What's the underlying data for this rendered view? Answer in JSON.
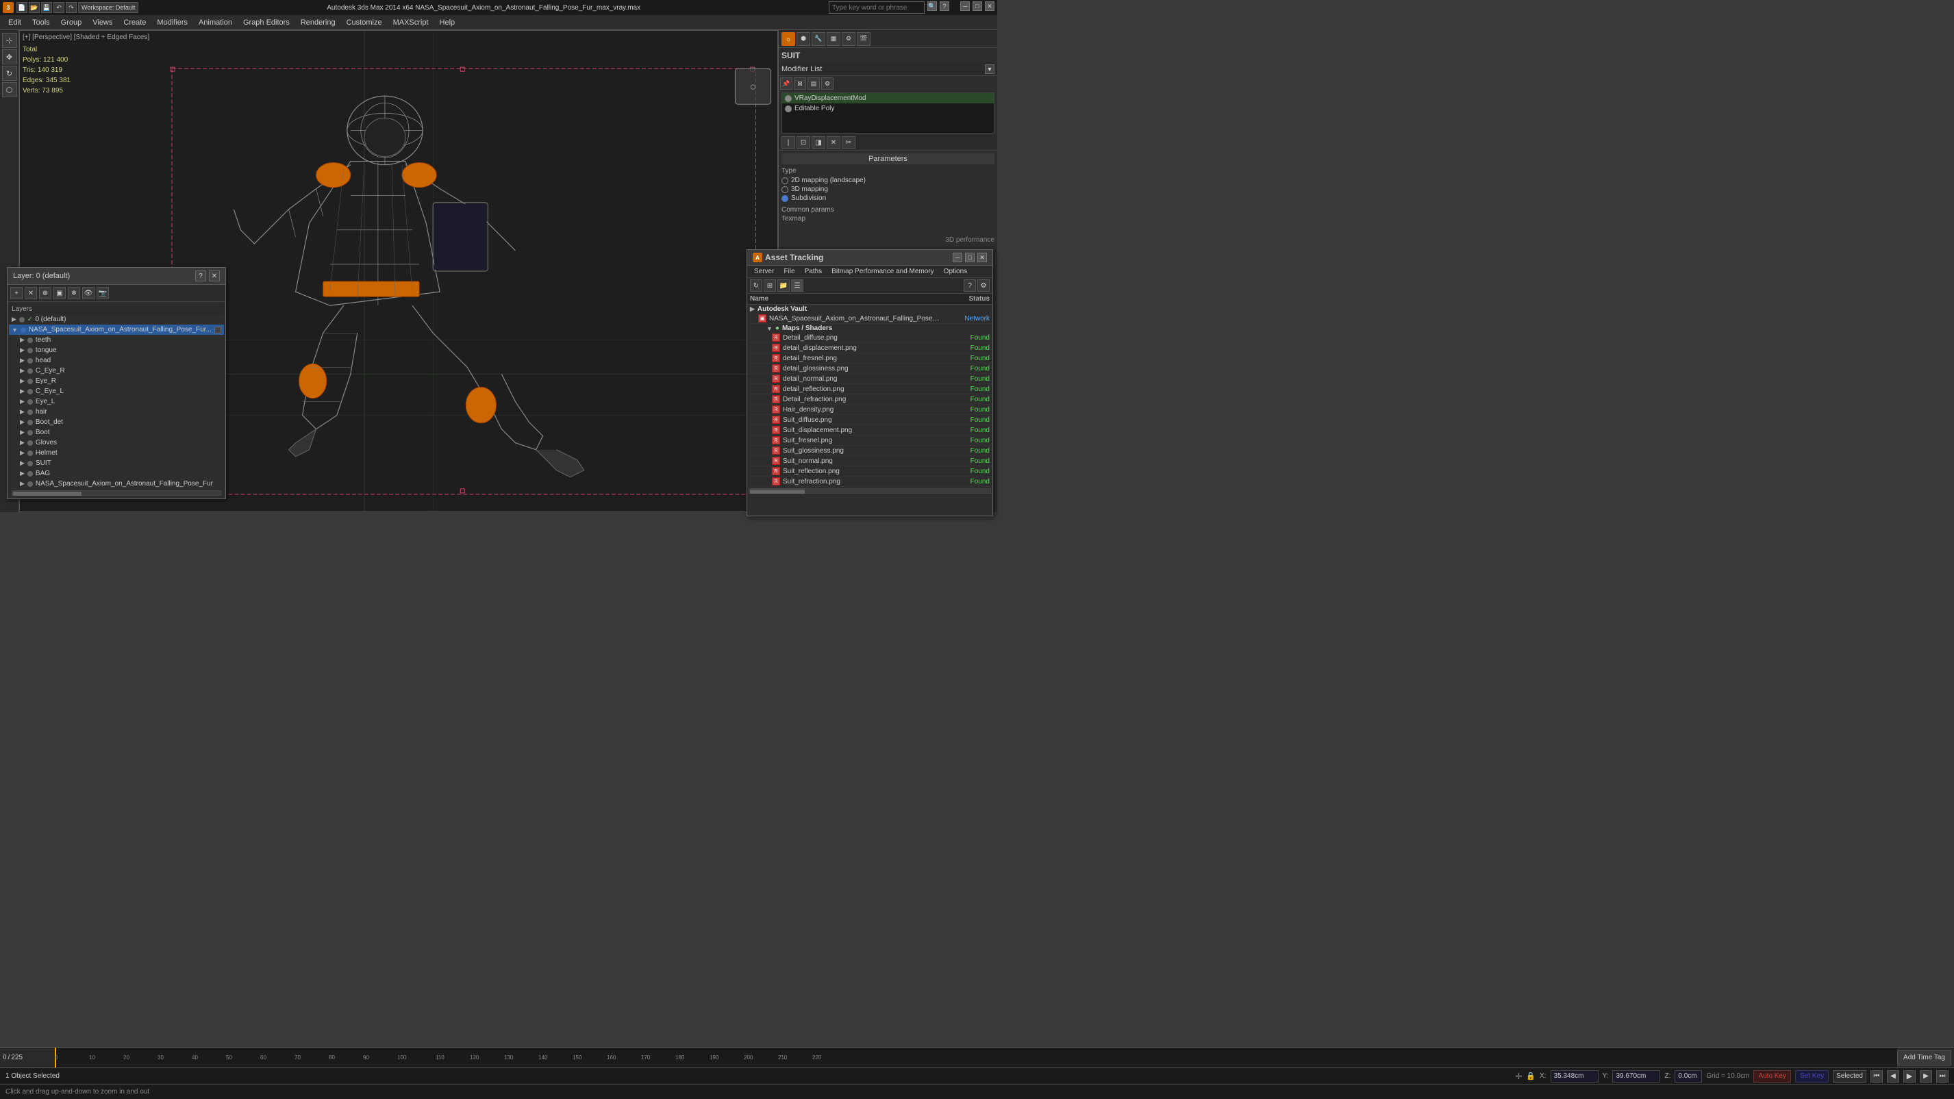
{
  "titlebar": {
    "title": "Autodesk 3ds Max  2014 x64     NASA_Spacesuit_Axiom_on_Astronaut_Falling_Pose_Fur_max_vray.max",
    "app_icon": "3dsmax-icon",
    "min_label": "─",
    "max_label": "□",
    "close_label": "✕"
  },
  "toolbar": {
    "search_placeholder": "Type key word or phrase",
    "workspace_label": "Workspace: Default"
  },
  "menubar": {
    "items": [
      "Edit",
      "Tools",
      "Group",
      "Views",
      "Create",
      "Modifiers",
      "Animation",
      "Graph Editors",
      "Rendering",
      "Customize",
      "MAXScript",
      "Help"
    ]
  },
  "viewport": {
    "label": "[+] [Perspective] [Shaded + Edged Faces]",
    "stats": {
      "total_label": "Total",
      "polys_label": "Polys:",
      "polys_value": "121 400",
      "tris_label": "Tris:",
      "tris_value": "140 319",
      "edges_label": "Edges:",
      "edges_value": "345 381",
      "verts_label": "Verts:",
      "verts_value": "73 895"
    }
  },
  "right_panel": {
    "suit_label": "SUIT",
    "modifier_list_label": "Modifier List",
    "modifiers": [
      {
        "name": "VRayDisplacementMod"
      },
      {
        "name": "Editable Poly"
      }
    ],
    "params_title": "Parameters",
    "type_label": "Type",
    "type_options": [
      {
        "label": "2D mapping (landscape)",
        "selected": false
      },
      {
        "label": "3D mapping",
        "selected": false
      },
      {
        "label": "Subdivision",
        "selected": true
      }
    ],
    "common_params_label": "Common params",
    "texmap_label": "Texmap"
  },
  "layer_panel": {
    "title": "Layer: 0 (default)",
    "close_label": "✕",
    "help_label": "?",
    "layers_header": "Layers",
    "items": [
      {
        "label": "0 (default)",
        "indent": 0,
        "selected": false,
        "check": "✓"
      },
      {
        "label": "NASA_Spacesuit_Axiom_on_Astronaut_Falling_Pose_Fur...",
        "indent": 0,
        "selected": true
      },
      {
        "label": "teeth",
        "indent": 1,
        "selected": false
      },
      {
        "label": "tongue",
        "indent": 1,
        "selected": false
      },
      {
        "label": "head",
        "indent": 1,
        "selected": false
      },
      {
        "label": "C_Eye_R",
        "indent": 1,
        "selected": false
      },
      {
        "label": "Eye_R",
        "indent": 1,
        "selected": false
      },
      {
        "label": "C_Eye_L",
        "indent": 1,
        "selected": false
      },
      {
        "label": "Eye_L",
        "indent": 1,
        "selected": false
      },
      {
        "label": "hair",
        "indent": 1,
        "selected": false
      },
      {
        "label": "Boot_det",
        "indent": 1,
        "selected": false
      },
      {
        "label": "Boot",
        "indent": 1,
        "selected": false
      },
      {
        "label": "Gloves",
        "indent": 1,
        "selected": false
      },
      {
        "label": "Helmet",
        "indent": 1,
        "selected": false
      },
      {
        "label": "SUIT",
        "indent": 1,
        "selected": false
      },
      {
        "label": "BAG",
        "indent": 1,
        "selected": false
      },
      {
        "label": "NASA_Spacesuit_Axiom_on_Astronaut_Falling_Pose_Fur",
        "indent": 1,
        "selected": false
      }
    ]
  },
  "asset_tracking": {
    "title": "Asset Tracking",
    "server_menu": "Server",
    "file_menu": "File",
    "paths_menu": "Paths",
    "bitmap_menu": "Bitmap Performance and Memory",
    "options_menu": "Options",
    "columns": {
      "name": "Name",
      "status": "Status"
    },
    "items": [
      {
        "type": "group",
        "name": "Autodesk Vault",
        "indent": 0,
        "status": ""
      },
      {
        "type": "file",
        "name": "NASA_Spacesuit_Axiom_on_Astronaut_Falling_Pose_Fur_max_v...",
        "indent": 1,
        "status": "Network",
        "status_class": "status-network"
      },
      {
        "type": "group",
        "name": "Maps / Shaders",
        "indent": 2,
        "status": ""
      },
      {
        "type": "file",
        "name": "Detail_diffuse.png",
        "indent": 3,
        "status": "Found",
        "status_class": "status-found"
      },
      {
        "type": "file",
        "name": "detail_displacement.png",
        "indent": 3,
        "status": "Found",
        "status_class": "status-found"
      },
      {
        "type": "file",
        "name": "detail_fresnel.png",
        "indent": 3,
        "status": "Found",
        "status_class": "status-found"
      },
      {
        "type": "file",
        "name": "detail_glossiness.png",
        "indent": 3,
        "status": "Found",
        "status_class": "status-found"
      },
      {
        "type": "file",
        "name": "detail_normal.png",
        "indent": 3,
        "status": "Found",
        "status_class": "status-found"
      },
      {
        "type": "file",
        "name": "detail_reflection.png",
        "indent": 3,
        "status": "Found",
        "status_class": "status-found"
      },
      {
        "type": "file",
        "name": "Detail_refraction.png",
        "indent": 3,
        "status": "Found",
        "status_class": "status-found"
      },
      {
        "type": "file",
        "name": "Hair_density.png",
        "indent": 3,
        "status": "Found",
        "status_class": "status-found"
      },
      {
        "type": "file",
        "name": "Suit_diffuse.png",
        "indent": 3,
        "status": "Found",
        "status_class": "status-found"
      },
      {
        "type": "file",
        "name": "Suit_displacement.png",
        "indent": 3,
        "status": "Found",
        "status_class": "status-found"
      },
      {
        "type": "file",
        "name": "Suit_fresnel.png",
        "indent": 3,
        "status": "Found",
        "status_class": "status-found"
      },
      {
        "type": "file",
        "name": "Suit_glossiness.png",
        "indent": 3,
        "status": "Found",
        "status_class": "status-found"
      },
      {
        "type": "file",
        "name": "Suit_normal.png",
        "indent": 3,
        "status": "Found",
        "status_class": "status-found"
      },
      {
        "type": "file",
        "name": "Suit_reflection.png",
        "indent": 3,
        "status": "Found",
        "status_class": "status-found"
      },
      {
        "type": "file",
        "name": "Suit_refraction.png",
        "indent": 3,
        "status": "Found",
        "status_class": "status-found"
      }
    ]
  },
  "timeline": {
    "frame_current": "0",
    "frame_total": "225",
    "markers": [
      "0",
      "10",
      "20",
      "30",
      "40",
      "50",
      "60",
      "70",
      "80",
      "90",
      "100",
      "110",
      "120",
      "130",
      "140",
      "150",
      "160",
      "170",
      "180",
      "190",
      "200",
      "210",
      "220"
    ]
  },
  "statusbar": {
    "object_selected": "1 Object Selected",
    "hint": "Click and drag up-and-down to zoom in and out",
    "x_label": "X:",
    "x_value": "35.348cm",
    "y_label": "Y:",
    "y_value": "39.670cm",
    "z_label": "Z:",
    "z_value": "0.0cm",
    "grid_label": "Grid = 10.0cm",
    "auto_key_label": "Auto Key",
    "set_key_label": "Set Key",
    "selected_label": "Selected",
    "add_time_tag_label": "Add Time Tag"
  }
}
